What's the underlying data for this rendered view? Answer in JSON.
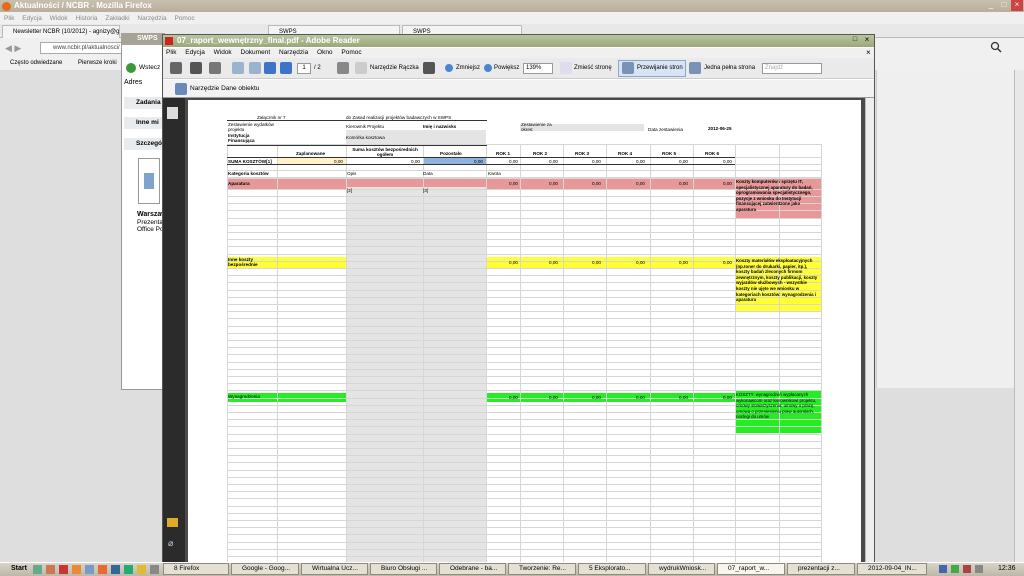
{
  "firefox": {
    "title": "Aktualności / NCBR - Mozilla Firefox",
    "menu": [
      "Plik",
      "Edycja",
      "Widok",
      "Historia",
      "Zakładki",
      "Narzędzia",
      "Pomoc"
    ],
    "tabs": [
      "Newsletter NCBR (10/2012) - agnizy@gm...",
      "SWPS",
      "SWPS"
    ],
    "url": "www.ncbir.pl/aktualnosci/",
    "bookmarks": [
      "Często odwiedzane",
      "Pierwsze kroki"
    ]
  },
  "mid": {
    "title": "SWPS",
    "rows": [
      "Zadania",
      "Inne mi",
      "Szczegó"
    ],
    "file_label": "Warszaw",
    "file_sub": "Prezentac",
    "file_sub2": "Office Po",
    "back": "Wstecz",
    "address": "Adres"
  },
  "reader": {
    "title": "07_raport_wewnętrzny_final.pdf - Adobe Reader",
    "menu": [
      "Plik",
      "Edycja",
      "Widok",
      "Dokument",
      "Narzędzia",
      "Okno",
      "Pomoc"
    ],
    "page_current": "1",
    "page_total": "/ 2",
    "tool_hand": "Narzędzie Rączka",
    "zoom_out": "Zmniejsz",
    "zoom_in": "Powiększ",
    "zoom": "139%",
    "fit_page": "Zmieść stronę",
    "scroll_pages": "Przewijanie stron",
    "one_page": "Jedna pełna strona",
    "find": "Znajdź",
    "object_tool": "Narzędzie Dane obiektu"
  },
  "sheet": {
    "annex": "Załącznik nr 7",
    "rules": "do Zasad realizacji projektów badawczych w SWPS",
    "authors_label": "Zestawienie wydatków projektu",
    "manager_label": "Kierownik Projektu",
    "name_label": "Imię i nazwisko",
    "period_label": "Zestawienie za okres:",
    "institution_label": "Instytucja Finansująca",
    "unit_label": "Komórka kosztowa",
    "date_label": "Data zestawienia",
    "date": "2012-06-25",
    "col_planned": "Zaplanowane",
    "col_sum": "Suma kosztów bezpośrednich ogółem",
    "col_left": "Pozostało",
    "years": [
      "ROK 1",
      "ROK 2",
      "ROK 3",
      "ROK 4",
      "ROK 5",
      "ROK 6"
    ],
    "sum_label": "SUMA KOSZTÓW[1]",
    "zero": "0,00",
    "cat_label": "Kategoria kosztów",
    "desc_label": "Opis",
    "data_label": "Data",
    "amount_label": "Kwota",
    "apparatus": "Aparatura",
    "fn2": "[2]",
    "fn3": "[3]",
    "apparatus_note": "Koszty komputerów i sprzętu IT, specjalistycznej aparatury do badań, oprogramowania specjalistycznego, pozycje z wniosku do Instytucji finansującej zatwierdzone jako aparatura",
    "other": "Inne koszty bezpośrednie",
    "other_note": "Koszty materiałów eksploatacyjnych (np.toner do drukarki, papier, itp.), koszty badań zleconych firmom zewnętrznym, koszty publikacji, koszty wyjazdów służbowych - wszystkie koszty nie ujęte we wniosku w kategoriach kosztów: wynagrodzenia i aparatura",
    "salary": "Wynagrodzenia",
    "salary_note": "KOSZTY: wynagrodzeń wypłacanych wykonawcom oraz kierownikowi projektu, umowy stowarzyszenia: umowy o pracę, umowa o przeniesieniu praw autorskich, noclegi do umów"
  },
  "taskbar": {
    "start": "Start",
    "tasks": [
      "8 Firefox",
      "Google - Goog...",
      "Wirtualna Ucz...",
      "Biuro Obsługi ...",
      "Odebrane - ba...",
      "Tworzenie: Re...",
      "5 Eksplorato...",
      "wydrukWniosk...",
      "07_raport_w...",
      "prezentacji z...",
      "2012-09-04_IN..."
    ],
    "clock": "12:36"
  },
  "colors": {
    "red": "#e89898",
    "yellow": "#ffff33",
    "green": "#22ee22",
    "blue": "#8fb4dd",
    "beige": "#fff2c8"
  }
}
